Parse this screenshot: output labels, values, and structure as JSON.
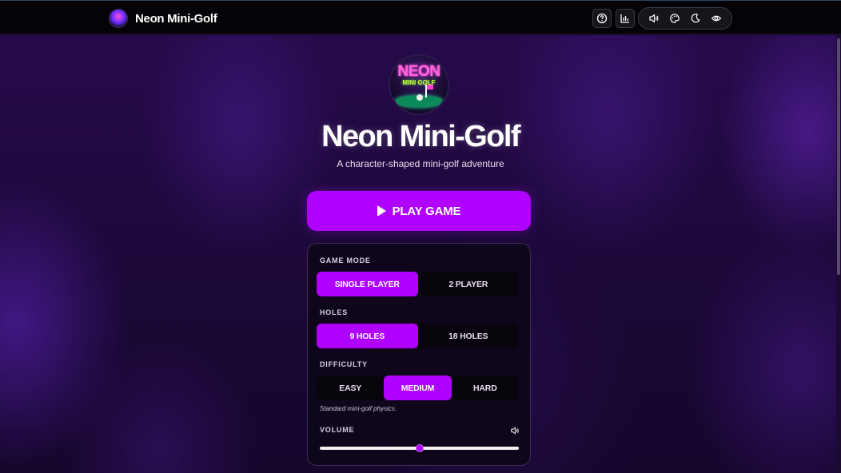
{
  "header": {
    "app_name": "Neon Mini-Golf",
    "buttons": [
      {
        "name": "help-icon"
      },
      {
        "name": "stats-icon"
      }
    ],
    "settings_group": [
      {
        "name": "sound-icon"
      },
      {
        "name": "palette-icon"
      },
      {
        "name": "moon-icon"
      },
      {
        "name": "eye-icon"
      }
    ]
  },
  "hero": {
    "logo_word1": "NEON",
    "logo_word2": "MINI GOLF",
    "title": "Neon Mini-Golf",
    "subtitle": "A character-shaped mini-golf adventure"
  },
  "play_button": {
    "label": "PLAY GAME",
    "icon": "play-icon"
  },
  "settings": {
    "game_mode": {
      "label": "GAME MODE",
      "options": [
        "SINGLE PLAYER",
        "2 PLAYER"
      ],
      "selected": "SINGLE PLAYER"
    },
    "holes": {
      "label": "HOLES",
      "options": [
        "9 HOLES",
        "18 HOLES"
      ],
      "selected": "9 HOLES"
    },
    "difficulty": {
      "label": "DIFFICULTY",
      "options": [
        "EASY",
        "MEDIUM",
        "HARD"
      ],
      "selected": "MEDIUM",
      "hint": "Standard mini-golf physics."
    },
    "volume": {
      "label": "VOLUME",
      "icon": "speaker-icon",
      "value": 0.5
    }
  },
  "colors": {
    "accent": "#b000ff",
    "topbar": "#050307",
    "background": "#1a0836",
    "panel": "#0e061a"
  }
}
